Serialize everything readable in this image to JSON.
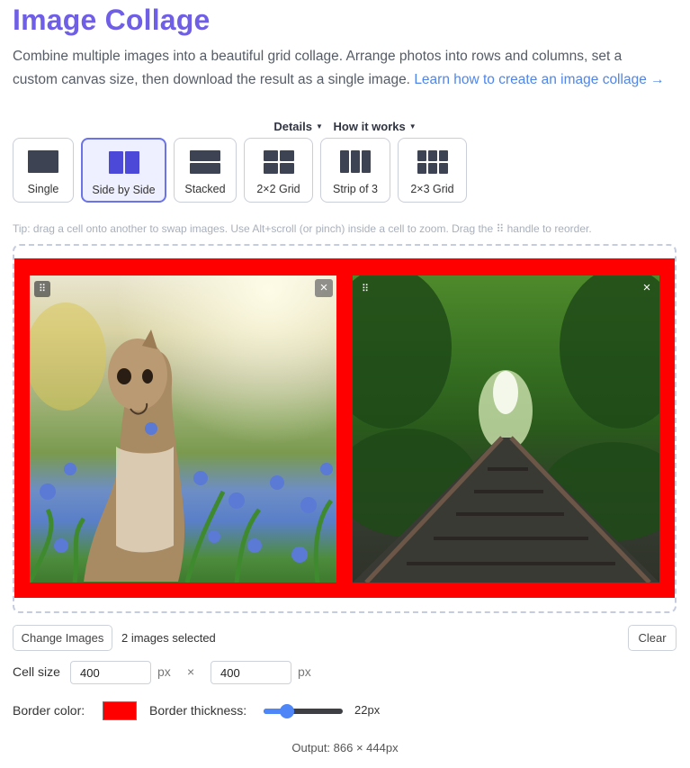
{
  "header": {
    "title": "Image Collage",
    "intro_line1": "Combine multiple images into a beautiful grid collage. Arrange photos into rows and columns, set a",
    "intro_line2": "custom canvas size, then download the result as a single image. ",
    "intro_link": "Learn how to create an image collage →"
  },
  "links": {
    "details": "Details",
    "how_it_works": "How it works"
  },
  "layouts": [
    {
      "label": "Single",
      "selected": false
    },
    {
      "label": "Side by Side",
      "selected": true
    },
    {
      "label": "Stacked",
      "selected": false
    },
    {
      "label": "2×2 Grid",
      "selected": false
    },
    {
      "label": "Strip of 3",
      "selected": false
    },
    {
      "label": "2×3 Grid",
      "selected": false
    }
  ],
  "tip": "Tip: drag a cell onto another to swap images. Use Alt+scroll (or pinch) inside a cell to zoom. Drag the ⠿ handle to reorder.",
  "cells": [
    {
      "image": "chipmunk-in-blue-flowers",
      "handle_icon": "⠿",
      "close_icon": "×"
    },
    {
      "image": "railway-tracks-through-forest",
      "handle_icon": "⠿",
      "close_icon": "×"
    }
  ],
  "controls": {
    "change_label": "Change Images",
    "selected_text": "2 images selected",
    "clear_label": "Clear",
    "cell_size_label": "Cell size",
    "width_value": "400",
    "height_value": "400",
    "unit": "px",
    "times": "×",
    "border_color_label": "Border color:",
    "border_color": "#ff0000",
    "border_thickness_label": "Border thickness:",
    "border_thickness_value": "22px",
    "border_thickness_fraction": 0.3
  },
  "output": "Output: 866 × 444px",
  "colors": {
    "accent": "#6f5ee6",
    "link": "#4f86e8",
    "active_layout": "#6a73e8"
  }
}
